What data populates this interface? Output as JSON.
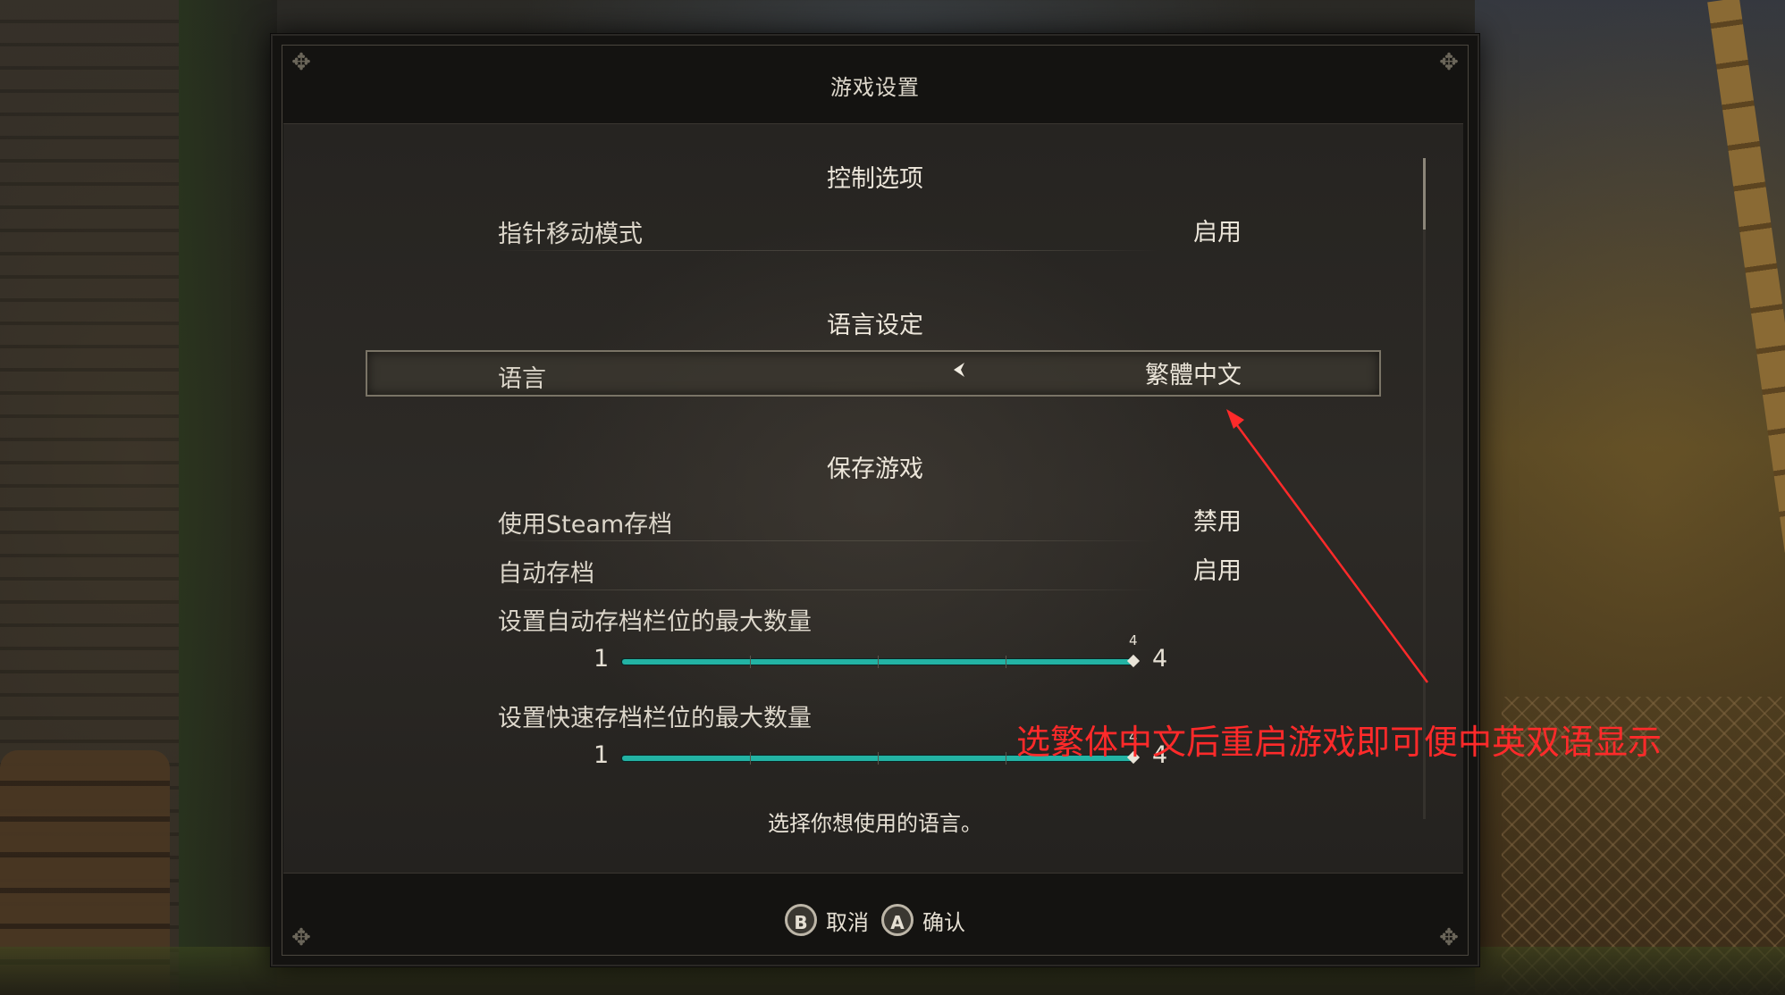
{
  "dialog": {
    "title": "游戏设置",
    "hint": "选择你想使用的语言。"
  },
  "sections": {
    "control": "控制选项",
    "language": "语言设定",
    "save": "保存游戏"
  },
  "rows": {
    "pointer_mode": {
      "label": "指针移动模式",
      "value": "启用"
    },
    "language": {
      "label": "语言",
      "value": "繁體中文"
    },
    "steam_save": {
      "label": "使用Steam存档",
      "value": "禁用"
    },
    "autosave": {
      "label": "自动存档",
      "value": "启用"
    }
  },
  "sliders": {
    "autosave_slots": {
      "label": "设置自动存档栏位的最大数量",
      "min": "1",
      "max": "4",
      "value": "4",
      "fraction": 1.0
    },
    "quicksave_slots": {
      "label": "设置快速存档栏位的最大数量",
      "min": "1",
      "max": "4",
      "value": "4",
      "fraction": 1.0
    }
  },
  "footer": {
    "cancel_key": "B",
    "cancel_label": "取消",
    "confirm_key": "A",
    "confirm_label": "确认"
  },
  "annotation": {
    "text": "选繁体中文后重启游戏即可便中英双语显示",
    "color": "#ff2a2a"
  },
  "colors": {
    "slider_fill": "#23b3a4",
    "slider_track": "#14423f"
  }
}
